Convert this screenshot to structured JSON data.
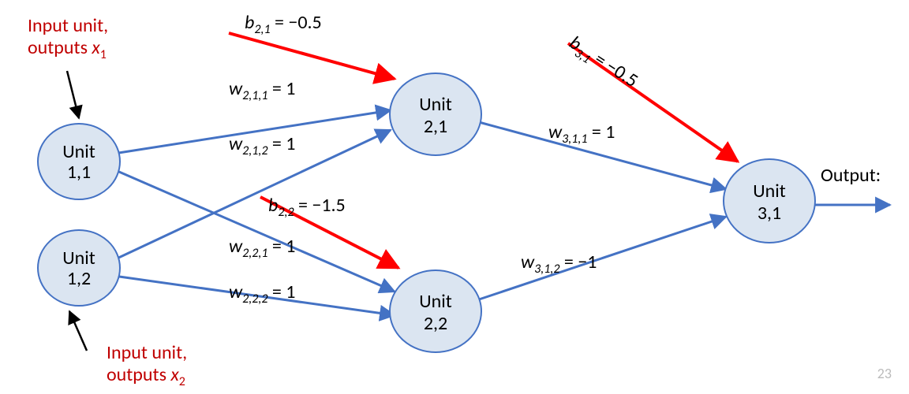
{
  "nodes": {
    "u11": {
      "line1": "Unit",
      "line2": "1,1"
    },
    "u12": {
      "line1": "Unit",
      "line2": "1,2"
    },
    "u21": {
      "line1": "Unit",
      "line2": "2,1"
    },
    "u22": {
      "line1": "Unit",
      "line2": "2,2"
    },
    "u31": {
      "line1": "Unit",
      "line2": "3,1"
    }
  },
  "weights": {
    "w211": {
      "sym": "w",
      "sub": "2,1,1",
      "val": " = 1"
    },
    "w212": {
      "sym": "w",
      "sub": "2,1,2",
      "val": " = 1"
    },
    "w221": {
      "sym": "w",
      "sub": "2,2,1",
      "val": " = 1"
    },
    "w222": {
      "sym": "w",
      "sub": "2,2,2",
      "val": " = 1"
    },
    "w311": {
      "sym": "w",
      "sub": "3,1,1",
      "val": " = 1"
    },
    "w312": {
      "sym": "w",
      "sub": "3,1,2",
      "val": " = −1"
    }
  },
  "biases": {
    "b21": {
      "sym": "b",
      "sub": "2,1",
      "val": " = −0.5"
    },
    "b22": {
      "sym": "b",
      "sub": "2,2",
      "val": " = −1.5"
    },
    "b31": {
      "sym": "b",
      "sub": "3,1",
      "val": " = −0.5"
    }
  },
  "annotations": {
    "in1_l1": "Input unit,",
    "in1_l2a": "outputs ",
    "in1_l2b": "x",
    "in1_l2c": "1",
    "in2_l1": "Input unit,",
    "in2_l2a": "outputs ",
    "in2_l2b": "x",
    "in2_l2c": "2",
    "out": "Output:"
  },
  "page": "23"
}
